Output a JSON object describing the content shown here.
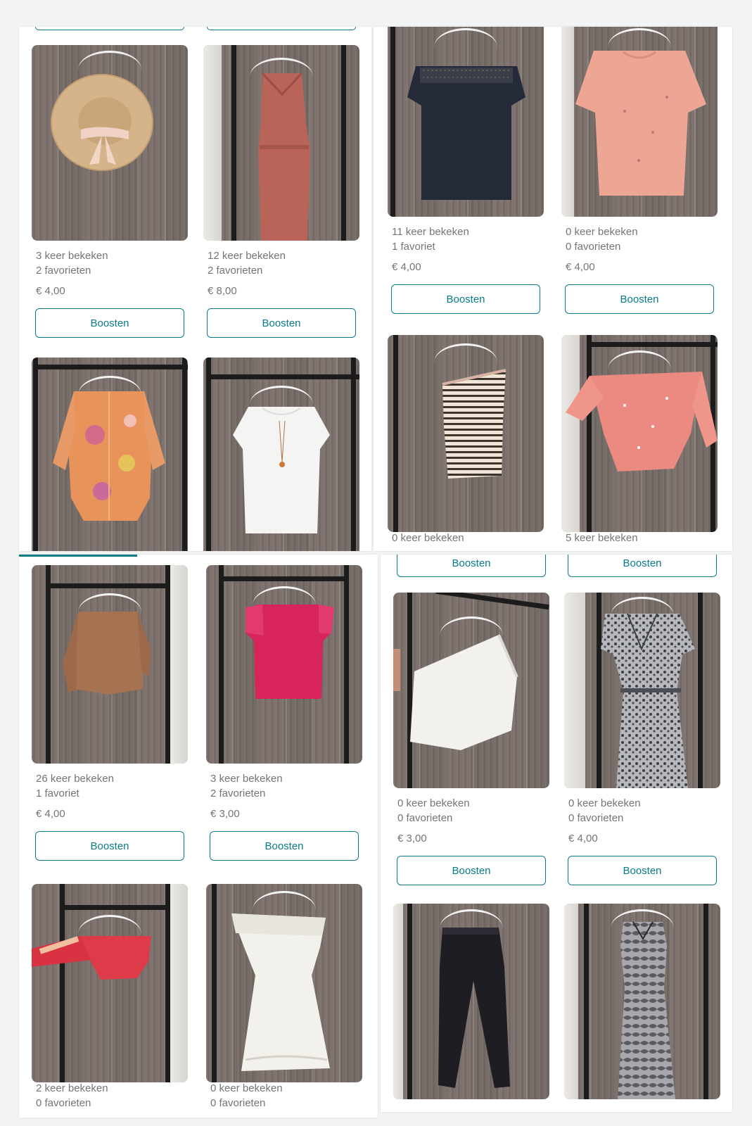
{
  "colors": {
    "accent": "#0a7b88",
    "muted_text": "#757575",
    "panel": "#ffffff",
    "background": "#f2f3f3"
  },
  "panels": [
    {
      "cards": [
        {
          "item": "straw-hat",
          "views": "3 keer bekeken",
          "favorites": "2 favorieten",
          "price": "€ 4,00",
          "boost": "Boosten"
        },
        {
          "item": "rust-maxi-dress",
          "views": "12 keer bekeken",
          "favorites": "2 favorieten",
          "price": "€ 8,00",
          "boost": "Boosten"
        },
        {
          "item": "floral-kimono"
        },
        {
          "item": "white-tunic"
        }
      ]
    },
    {
      "cards": [
        {
          "item": "navy-lace-top",
          "views": "11 keer bekeken",
          "favorites": "1 favoriet",
          "price": "€ 4,00",
          "boost": "Boosten"
        },
        {
          "item": "pink-tshirt",
          "views": "0 keer bekeken",
          "favorites": "0 favorieten",
          "price": "€ 4,00",
          "boost": "Boosten"
        },
        {
          "item": "striped-one-shoulder-top",
          "views": "0 keer bekeken"
        },
        {
          "item": "coral-offshoulder-top",
          "views": "5 keer bekeken"
        }
      ]
    },
    {
      "cards": [
        {
          "item": "camel-sweater",
          "views": "26 keer bekeken",
          "favorites": "1 favoriet",
          "price": "€ 4,00",
          "boost": "Boosten"
        },
        {
          "item": "fuchsia-blouse",
          "views": "3 keer bekeken",
          "favorites": "2 favorieten",
          "price": "€ 3,00",
          "boost": "Boosten"
        },
        {
          "item": "red-offshoulder-crop",
          "views": "2 keer bekeken",
          "favorites": "0 favorieten"
        },
        {
          "item": "white-lace-dress",
          "views": "0 keer bekeken",
          "favorites": "0 favorieten"
        }
      ]
    },
    {
      "boost_above": "Boosten",
      "cards": [
        {
          "item": "white-one-shoulder-top",
          "views": "0 keer bekeken",
          "favorites": "0 favorieten",
          "price": "€ 3,00",
          "boost": "Boosten"
        },
        {
          "item": "leopard-maxi-dress",
          "views": "0 keer bekeken",
          "favorites": "0 favorieten",
          "price": "€ 4,00",
          "boost": "Boosten"
        },
        {
          "item": "black-leggings"
        },
        {
          "item": "snake-print-dress"
        }
      ]
    }
  ],
  "progress": {
    "fraction": 0.33
  }
}
